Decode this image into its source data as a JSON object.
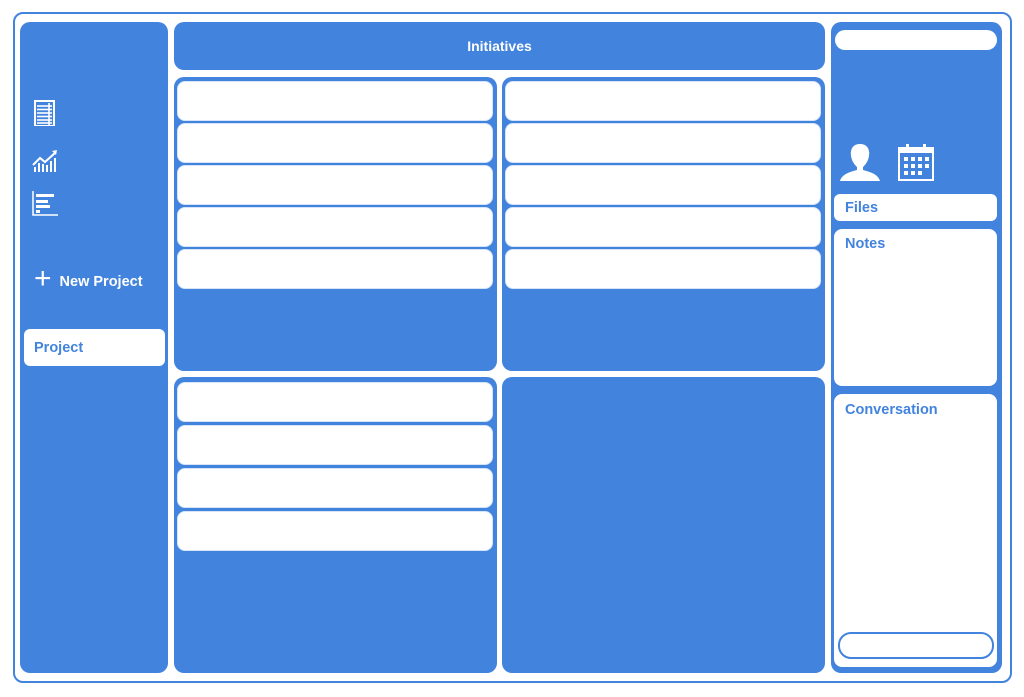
{
  "colors": {
    "accent": "#4283de",
    "surface": "#ffffff"
  },
  "sidebar": {
    "icons": [
      "document-list-icon",
      "line-chart-icon",
      "bar-chart-icon"
    ],
    "new_project_icon": "plus-icon",
    "new_project_label": "New Project",
    "items": [
      {
        "label": "Project",
        "selected": true
      }
    ]
  },
  "header": {
    "title": "Initiatives"
  },
  "quadrants": [
    {
      "rows": [
        "",
        "",
        "",
        "",
        ""
      ]
    },
    {
      "rows": [
        "",
        "",
        "",
        "",
        ""
      ]
    },
    {
      "rows": [
        "",
        "",
        "",
        ""
      ]
    },
    {
      "rows": []
    }
  ],
  "right_panel": {
    "search": {
      "value": "",
      "placeholder": ""
    },
    "icons": [
      "user-icon",
      "calendar-icon"
    ],
    "files_label": "Files",
    "notes_label": "Notes",
    "conversation_label": "Conversation",
    "message_input": {
      "value": "",
      "placeholder": ""
    }
  }
}
